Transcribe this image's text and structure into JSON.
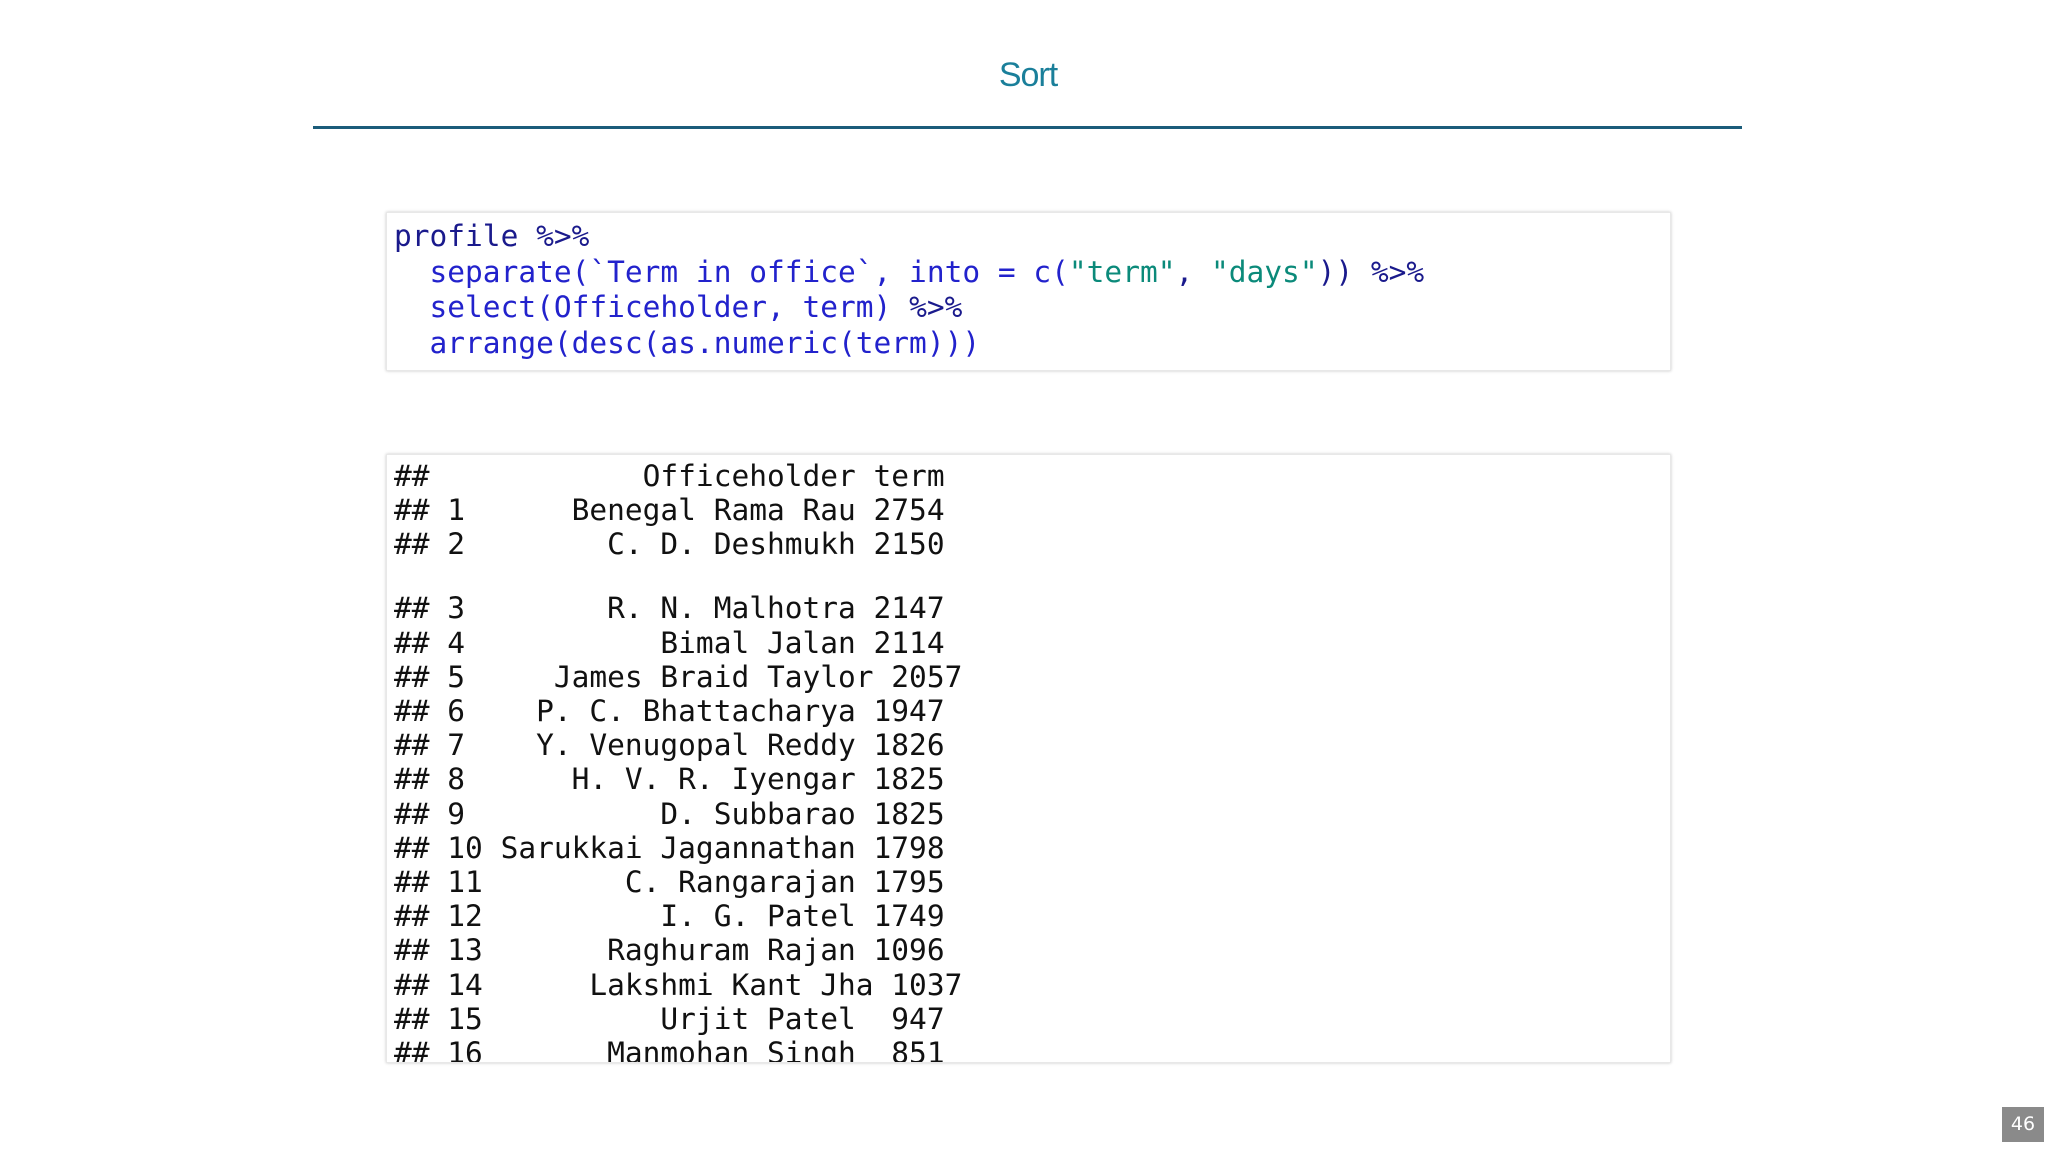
{
  "slide": {
    "title": "Sort",
    "page_number": "46"
  },
  "code": {
    "lines": [
      [
        {
          "t": "profile ",
          "k": "id"
        },
        {
          "t": "%>%",
          "k": "op"
        }
      ],
      [
        {
          "t": "  separate(`Term in office`, into = c(",
          "k": "fn"
        },
        {
          "t": "\"term\"",
          "k": "str"
        },
        {
          "t": ", ",
          "k": "id"
        },
        {
          "t": "\"days\"",
          "k": "str"
        },
        {
          "t": ")) ",
          "k": "id"
        },
        {
          "t": "%>%",
          "k": "op"
        }
      ],
      [
        {
          "t": "  select(Officeholder, term) ",
          "k": "fn"
        },
        {
          "t": "%>%",
          "k": "op"
        }
      ],
      [
        {
          "t": "  arrange(desc(as.numeric(term)))",
          "k": "fn"
        }
      ]
    ]
  },
  "output": {
    "lines": [
      "##            Officeholder term",
      "## 1      Benegal Rama Rau 2754",
      "## 2        C. D. Deshmukh 2150",
      "## 3        R. N. Malhotra 2147",
      "## 4           Bimal Jalan 2114",
      "## 5     James Braid Taylor 2057",
      "## 6    P. C. Bhattacharya 1947",
      "## 7    Y. Venugopal Reddy 1826",
      "## 8      H. V. R. Iyengar 1825",
      "## 9           D. Subbarao 1825",
      "## 10 Sarukkai Jagannathan 1798",
      "## 11        C. Rangarajan 1795",
      "## 12          I. G. Patel 1749",
      "## 13       Raghuram Rajan 1096",
      "## 14      Lakshmi Kant Jha 1037",
      "## 15          Urjit Patel  947",
      "## 16       Manmohan Singh  851"
    ]
  }
}
